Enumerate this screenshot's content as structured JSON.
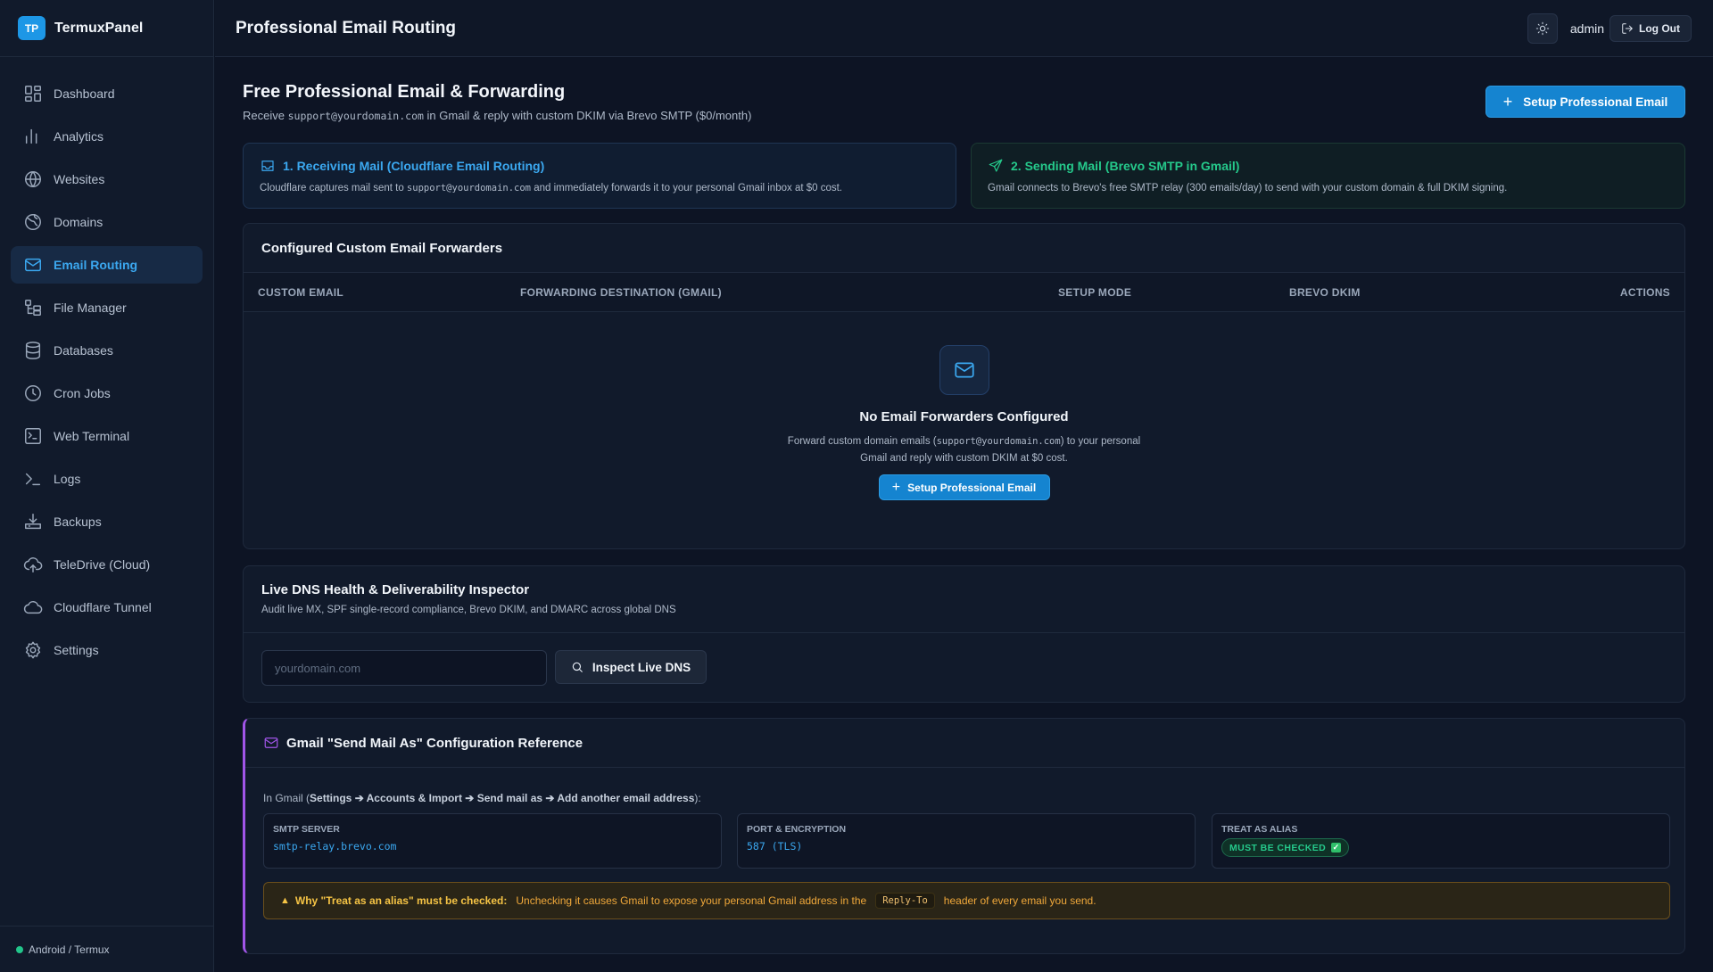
{
  "brand": {
    "logo_text": "TP",
    "name": "TermuxPanel"
  },
  "sidebar": {
    "items": [
      {
        "label": "Dashboard",
        "icon": "dashboard-icon",
        "active": false
      },
      {
        "label": "Analytics",
        "icon": "analytics-icon",
        "active": false
      },
      {
        "label": "Websites",
        "icon": "globe-icon",
        "active": false
      },
      {
        "label": "Domains",
        "icon": "domains-icon",
        "active": false
      },
      {
        "label": "Email Routing",
        "icon": "mail-icon",
        "active": true
      },
      {
        "label": "File Manager",
        "icon": "file-manager-icon",
        "active": false
      },
      {
        "label": "Databases",
        "icon": "database-icon",
        "active": false
      },
      {
        "label": "Cron Jobs",
        "icon": "clock-icon",
        "active": false
      },
      {
        "label": "Web Terminal",
        "icon": "terminal-window-icon",
        "active": false
      },
      {
        "label": "Logs",
        "icon": "logs-icon",
        "active": false
      },
      {
        "label": "Backups",
        "icon": "backup-icon",
        "active": false
      },
      {
        "label": "TeleDrive (Cloud)",
        "icon": "cloud-upload-icon",
        "active": false
      },
      {
        "label": "Cloudflare Tunnel",
        "icon": "cloud-icon",
        "active": false
      },
      {
        "label": "Settings",
        "icon": "gear-icon",
        "active": false
      }
    ],
    "footer": "Android / Termux"
  },
  "topbar": {
    "title": "Professional Email Routing",
    "user": "admin",
    "logout_label": "Log Out"
  },
  "hero": {
    "title": "Free Professional Email & Forwarding",
    "sub_before": "Receive",
    "sub_code": "support@yourdomain.com",
    "sub_after": "in Gmail & reply with custom DKIM via Brevo SMTP ($0/month)",
    "button_label": "Setup Professional Email"
  },
  "info_cards": {
    "receiving": {
      "title": "1. Receiving Mail (Cloudflare Email Routing)",
      "text_before": "Cloudflare captures mail sent to",
      "text_code": "support@yourdomain.com",
      "text_after": "and immediately forwards it to your personal Gmail inbox at $0 cost."
    },
    "sending": {
      "title": "2. Sending Mail (Brevo SMTP in Gmail)",
      "text": "Gmail connects to Brevo's free SMTP relay (300 emails/day) to send with your custom domain & full DKIM signing."
    }
  },
  "forwarders": {
    "title": "Configured Custom Email Forwarders",
    "columns": [
      "CUSTOM EMAIL",
      "FORWARDING DESTINATION (GMAIL)",
      "SETUP MODE",
      "BREVO DKIM",
      "ACTIONS"
    ],
    "empty_title": "No Email Forwarders Configured",
    "empty_text_before": "Forward custom domain emails (",
    "empty_text_code": "support@yourdomain.com",
    "empty_text_after": ") to your personal Gmail and reply with custom DKIM at $0 cost.",
    "empty_button_label": "Setup Professional Email"
  },
  "dns": {
    "title": "Live DNS Health & Deliverability Inspector",
    "subtitle": "Audit live MX, SPF single-record compliance, Brevo DKIM, and DMARC across global DNS",
    "placeholder": "yourdomain.com",
    "button_label": "Inspect Live DNS"
  },
  "gmail": {
    "title": "Gmail \"Send Mail As\" Configuration Reference",
    "intro_before": "In Gmail (",
    "intro_path": "Settings ➔ Accounts & Import ➔ Send mail as ➔ Add another email address",
    "intro_after": "):",
    "smtp_label": "SMTP SERVER",
    "smtp_value": "smtp-relay.brevo.com",
    "port_label": "PORT & ENCRYPTION",
    "port_value": "587 (TLS)",
    "alias_label": "TREAT AS ALIAS",
    "alias_badge": "MUST BE CHECKED",
    "warning_title": "Why \"Treat as an alias\" must be checked:",
    "warning_before": "Unchecking it causes Gmail to expose your personal Gmail address in the",
    "warning_code": "Reply-To",
    "warning_after": "header of every email you send."
  },
  "colors": {
    "accent": "#1584d0",
    "active_text": "#3ba8f0",
    "success": "#25c98b",
    "purple": "#a155e8",
    "warning": "#f0a83a"
  }
}
